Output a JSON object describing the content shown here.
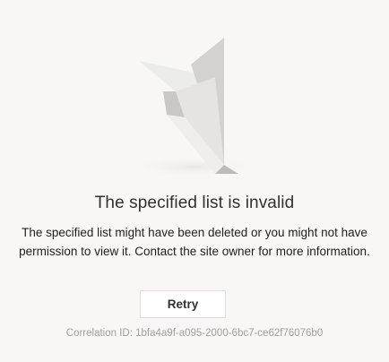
{
  "error": {
    "title": "The specified list is invalid",
    "message": "The specified list might have been deleted or you might not have permission to view it. Contact the site owner for more information.",
    "retry_label": "Retry",
    "correlation_label": "Correlation ID:",
    "correlation_id": "1bfa4a9f-a095-2000-6bc7-ce62f76076b0"
  },
  "illustration": {
    "icon": "paper-airplane-icon"
  },
  "colors": {
    "background": "#f8f7f6",
    "title": "#323130",
    "muted": "#a19f9d"
  }
}
